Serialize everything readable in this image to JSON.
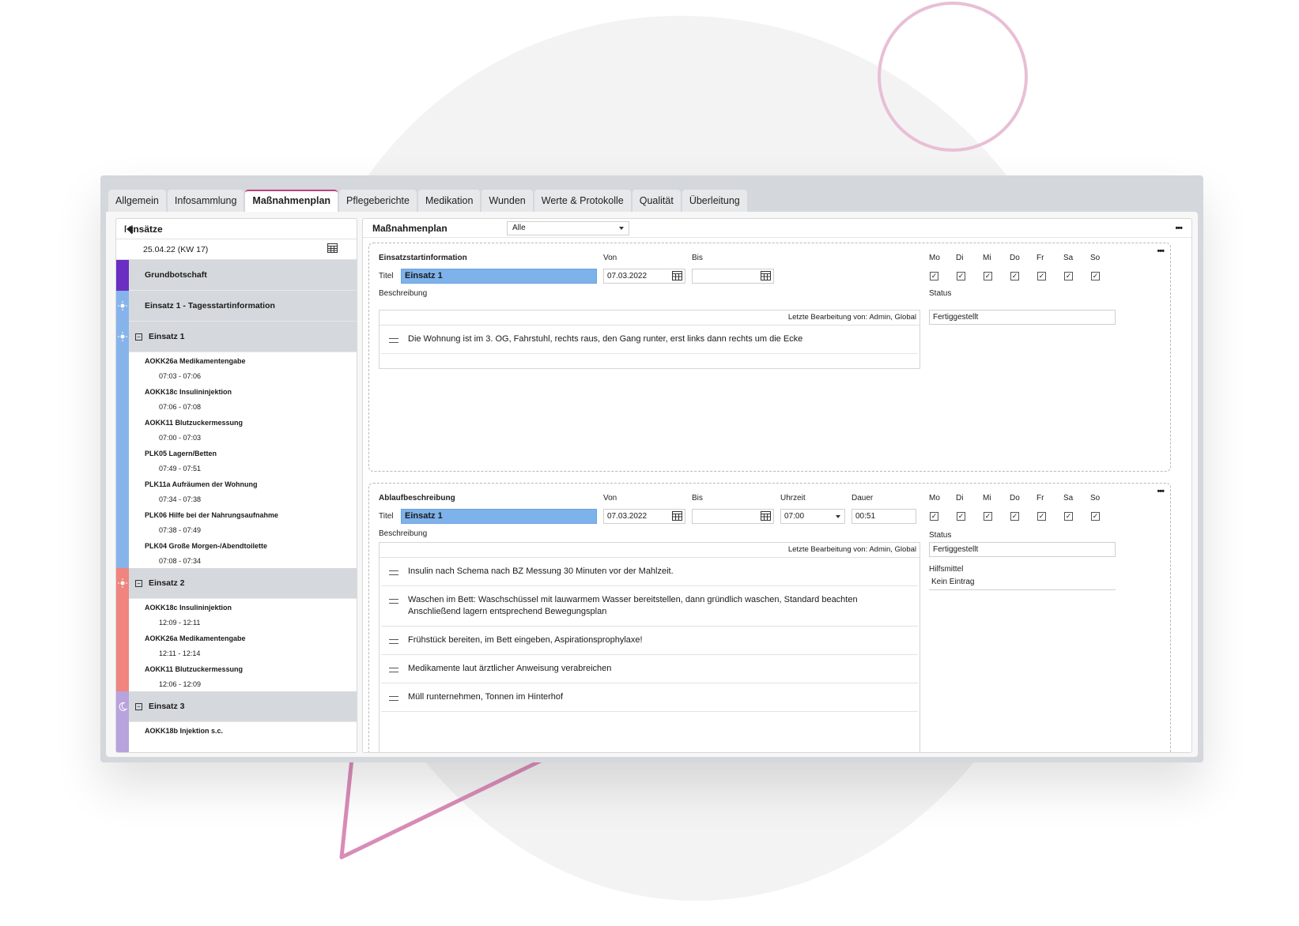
{
  "tabs": [
    "Allgemein",
    "Infosammlung",
    "Maßnahmenplan",
    "Pflegeberichte",
    "Medikation",
    "Wunden",
    "Werte & Protokolle",
    "Qualität",
    "Überleitung"
  ],
  "left": {
    "title": "Einsätze",
    "date": "25.04.22 (KW 17)",
    "groups": [
      {
        "label": "Grundbotschaft",
        "color": "#6a2fc2",
        "expander": false,
        "items": []
      },
      {
        "label": "Einsatz 1 - Tagesstartinformation",
        "color": "#86b4ea",
        "expander": false,
        "sun": true,
        "items": []
      },
      {
        "label": "Einsatz 1",
        "color": "#86b4ea",
        "expander": true,
        "sun": true,
        "items": [
          {
            "name": "AOKK26a Medikamentengabe",
            "time": "07:03 - 07:06"
          },
          {
            "name": "AOKK18c Insulininjektion",
            "time": "07:06 - 07:08"
          },
          {
            "name": "AOKK11 Blutzuckermessung",
            "time": "07:00 - 07:03"
          },
          {
            "name": "PLK05 Lagern/Betten",
            "time": "07:49 - 07:51"
          },
          {
            "name": "PLK11a Aufräumen der Wohnung",
            "time": "07:34 - 07:38"
          },
          {
            "name": "PLK06 Hilfe bei der Nahrungsaufnahme",
            "time": "07:38 - 07:49"
          },
          {
            "name": "PLK04 Große Morgen-/Abendtoilette",
            "time": "07:08 - 07:34"
          }
        ]
      },
      {
        "label": "Einsatz 2",
        "color": "#ef857e",
        "expander": true,
        "sun": true,
        "items": [
          {
            "name": "AOKK18c Insulininjektion",
            "time": "12:09 - 12:11"
          },
          {
            "name": "AOKK26a Medikamentengabe",
            "time": "12:11 - 12:14"
          },
          {
            "name": "AOKK11 Blutzuckermessung",
            "time": "12:06 - 12:09"
          }
        ]
      },
      {
        "label": "Einsatz 3",
        "color": "#b8a3dc",
        "expander": true,
        "moon": true,
        "items": [
          {
            "name": "AOKK18b Injektion s.c.",
            "time": ""
          }
        ]
      }
    ]
  },
  "right": {
    "title": "Maßnahmenplan",
    "filter": "Alle",
    "days": [
      "Mo",
      "Di",
      "Mi",
      "Do",
      "Fr",
      "Sa",
      "So"
    ],
    "section1": {
      "heading": "Einsatzstartinformation",
      "von_label": "Von",
      "bis_label": "Bis",
      "titel_label": "Titel",
      "titel": "Einsatz 1",
      "von": "07.03.2022",
      "bis": "",
      "beschreibung_label": "Beschreibung",
      "letzte": "Letzte Bearbeitung von:  Admin, Global",
      "status_label": "Status",
      "status": "Fertiggestellt",
      "rows": [
        "Die Wohnung ist im 3. OG, Fahrstuhl, rechts raus, den Gang runter, erst links dann rechts um die Ecke"
      ]
    },
    "section2": {
      "heading": "Ablaufbeschreibung",
      "von_label": "Von",
      "bis_label": "Bis",
      "uhrzeit_label": "Uhrzeit",
      "dauer_label": "Dauer",
      "titel_label": "Titel",
      "titel": "Einsatz 1",
      "von": "07.03.2022",
      "bis": "",
      "uhrzeit": "07:00",
      "dauer": "00:51",
      "beschreibung_label": "Beschreibung",
      "letzte": "Letzte Bearbeitung von:  Admin, Global",
      "status_label": "Status",
      "status": "Fertiggestellt",
      "hilfsmittel_label": "Hilfsmittel",
      "hilfsmittel": "Kein Eintrag",
      "rows": [
        "Insulin nach Schema nach BZ Messung 30 Minuten vor der Mahlzeit.",
        "Waschen im Bett: Waschschüssel mit lauwarmem Wasser bereitstellen, dann gründlich waschen, Standard beachten\nAnschließend lagern entsprechend Bewegungsplan",
        "Frühstück bereiten, im Bett eingeben, Aspirationsprophylaxe!",
        "Medikamente laut ärztlicher Anweisung verabreichen",
        "Müll runternehmen, Tonnen im Hinterhof"
      ]
    }
  },
  "colors": {
    "accent": "#c2407f",
    "title_highlight": "#7eb2ea"
  }
}
